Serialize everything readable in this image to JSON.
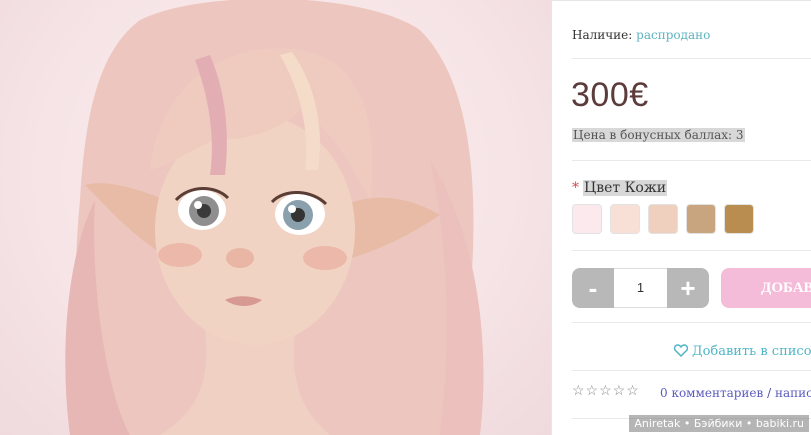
{
  "availability": {
    "label": "Наличие:",
    "value": "распродано"
  },
  "price": "300€",
  "bonus_points": "Цена в бонусных баллах: 3",
  "skin_option": {
    "required_mark": "*",
    "label": "Цвет Кожи",
    "swatches": [
      "#fbe9ee",
      "#f8e0d6",
      "#efcfbd",
      "#c9a57f",
      "#b98d4f"
    ]
  },
  "quantity": {
    "minus": "-",
    "value": "1",
    "plus": "+"
  },
  "add_button": "ДОБАВ",
  "wishlist": "Добавить в список",
  "reviews": {
    "stars": "☆☆☆☆☆",
    "comments": "0 комментариев",
    "separator": " / ",
    "write": "написать"
  },
  "watermark": "Aniretak • Бэйбики • babiki.ru",
  "colors": {
    "price": "#5b3b3b",
    "link": "#4fb6c6",
    "add_button": "#f4bcd8",
    "qty_button": "#b8b8b8"
  }
}
